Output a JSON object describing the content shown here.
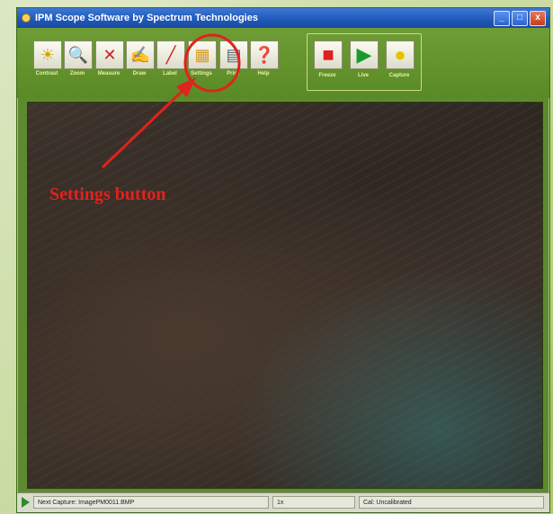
{
  "window": {
    "title": "IPM Scope Software by Spectrum Technologies",
    "minimize_label": "_",
    "maximize_label": "□",
    "close_label": "x"
  },
  "toolbar": {
    "tools": [
      {
        "id": "contrast",
        "label": "Contrast",
        "glyph": "☀",
        "icon": "lightbulb-icon",
        "color": "#d4a400"
      },
      {
        "id": "zoom",
        "label": "Zoom",
        "glyph": "🔍",
        "icon": "magnifier-icon",
        "color": "#333333"
      },
      {
        "id": "measure",
        "label": "Measure",
        "glyph": "✕",
        "icon": "measure-icon",
        "color": "#d02020"
      },
      {
        "id": "draw",
        "label": "Draw",
        "glyph": "✍",
        "icon": "draw-hand-icon",
        "color": "#c86a2a"
      },
      {
        "id": "label",
        "label": "Label",
        "glyph": "╱",
        "icon": "label-icon",
        "color": "#d02020"
      },
      {
        "id": "settings",
        "label": "Settings",
        "glyph": "▦",
        "icon": "settings-icon",
        "color": "#d89a20"
      },
      {
        "id": "print",
        "label": "Print",
        "glyph": "▤",
        "icon": "printer-icon",
        "color": "#556677"
      },
      {
        "id": "help",
        "label": "Help",
        "glyph": "❓",
        "icon": "help-icon",
        "color": "#111111"
      }
    ],
    "capture_tools": [
      {
        "id": "freeze",
        "label": "Freeze",
        "glyph": "■",
        "icon": "stop-icon",
        "color": "#e02020"
      },
      {
        "id": "live",
        "label": "Live",
        "glyph": "▶",
        "icon": "play-icon",
        "color": "#1a9a2a"
      },
      {
        "id": "capture",
        "label": "Capture",
        "glyph": "●",
        "icon": "capture-dot-icon",
        "color": "#e8c000"
      }
    ]
  },
  "annotation": {
    "text": "Settings button",
    "color": "#e0231c"
  },
  "statusbar": {
    "next_capture": "Next Capture: ImagePM0011.BMP",
    "zoom_level": "1x",
    "calibration": "Cal: Uncalibrated"
  }
}
